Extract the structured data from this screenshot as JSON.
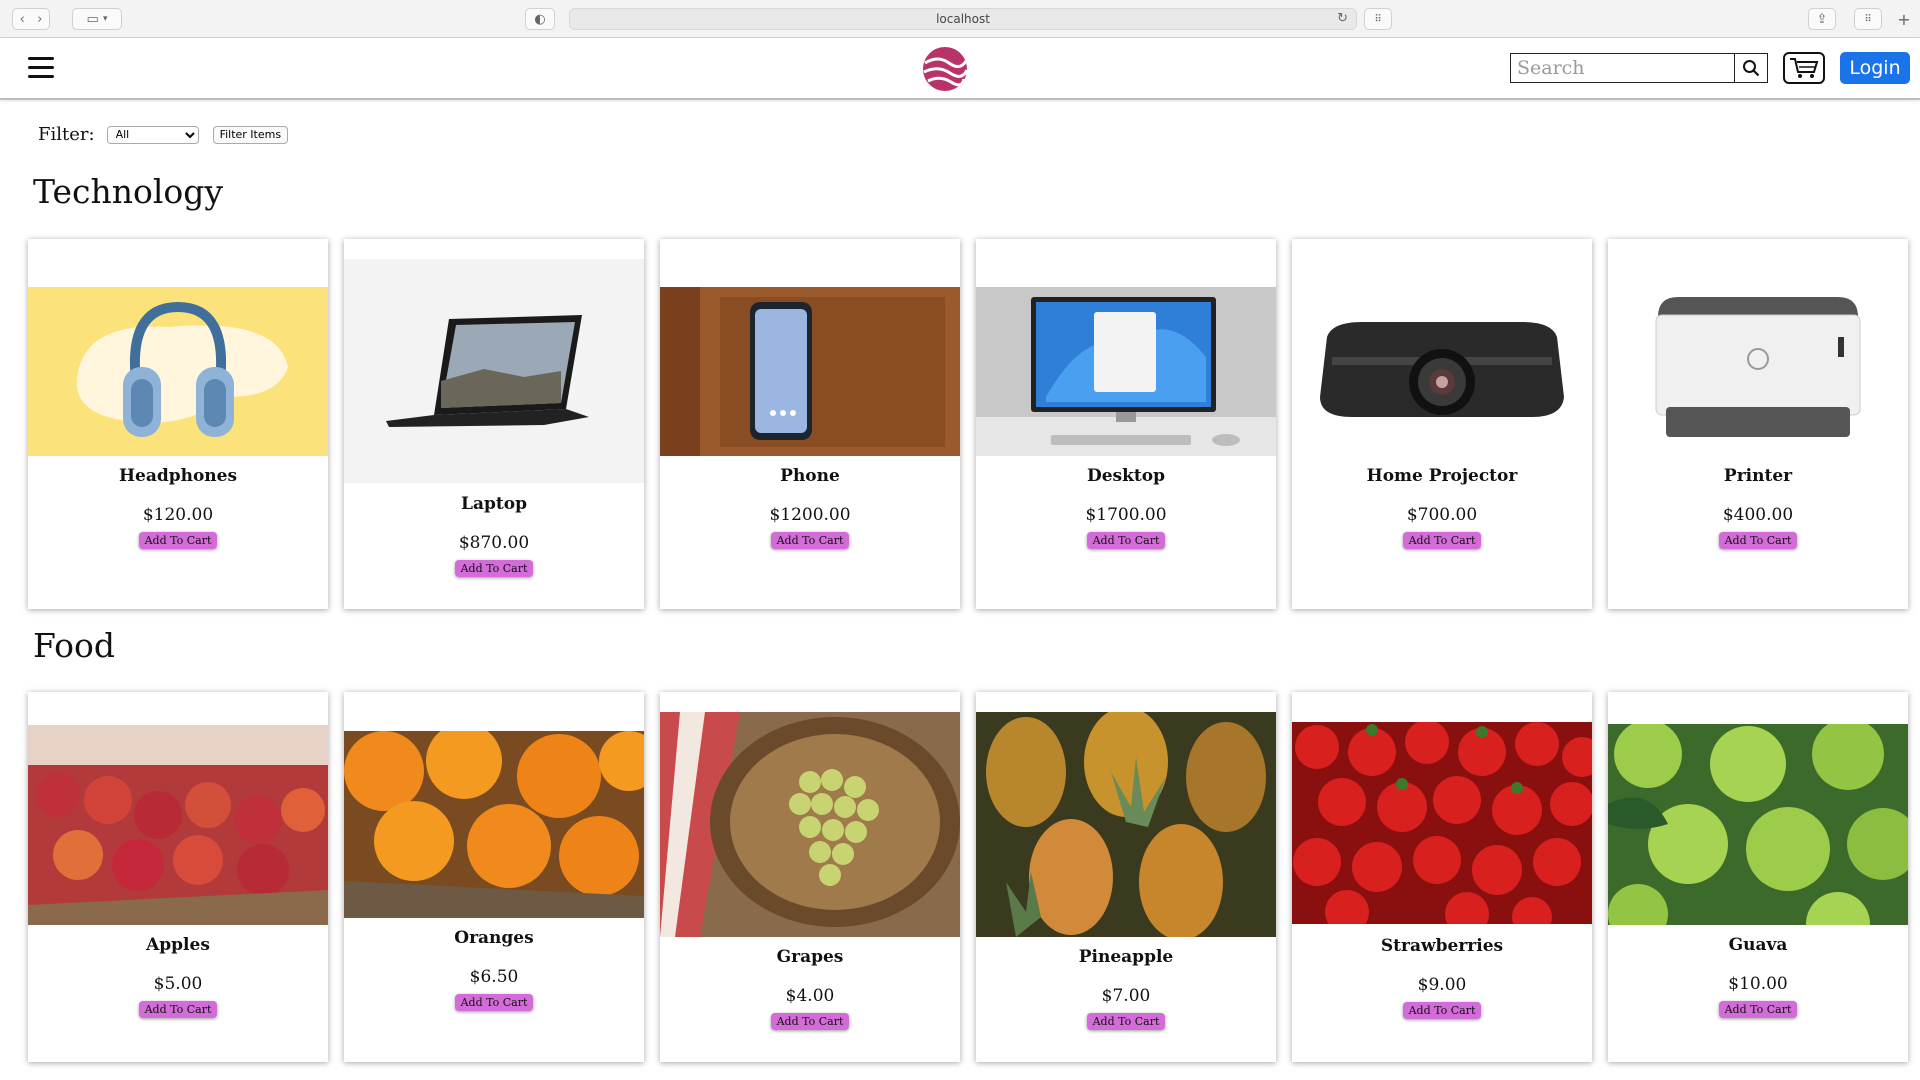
{
  "browser": {
    "url": "localhost"
  },
  "header": {
    "search_placeholder": "Search",
    "login_label": "Login"
  },
  "filter": {
    "label": "Filter:",
    "selected": "All",
    "button_label": "Filter Items"
  },
  "sections": [
    {
      "title": "Technology",
      "products": [
        {
          "name": "Headphones",
          "price": "$120.00",
          "button": "Add To Cart",
          "image": "headphones"
        },
        {
          "name": "Laptop",
          "price": "$870.00",
          "button": "Add To Cart",
          "image": "laptop"
        },
        {
          "name": "Phone",
          "price": "$1200.00",
          "button": "Add To Cart",
          "image": "phone"
        },
        {
          "name": "Desktop",
          "price": "$1700.00",
          "button": "Add To Cart",
          "image": "desktop"
        },
        {
          "name": "Home Projector",
          "price": "$700.00",
          "button": "Add To Cart",
          "image": "projector"
        },
        {
          "name": "Printer",
          "price": "$400.00",
          "button": "Add To Cart",
          "image": "printer"
        }
      ]
    },
    {
      "title": "Food",
      "products": [
        {
          "name": "Apples",
          "price": "$5.00",
          "button": "Add To Cart",
          "image": "apples"
        },
        {
          "name": "Oranges",
          "price": "$6.50",
          "button": "Add To Cart",
          "image": "oranges"
        },
        {
          "name": "Grapes",
          "price": "$4.00",
          "button": "Add To Cart",
          "image": "grapes"
        },
        {
          "name": "Pineapple",
          "price": "$7.00",
          "button": "Add To Cart",
          "image": "pineapple"
        },
        {
          "name": "Strawberries",
          "price": "$9.00",
          "button": "Add To Cart",
          "image": "strawberries"
        },
        {
          "name": "Guava",
          "price": "$10.00",
          "button": "Add To Cart",
          "image": "guava"
        }
      ]
    }
  ],
  "colors": {
    "login": "#1a73e8",
    "add_to_cart": "#d36bd8",
    "logo": "#b8336a"
  }
}
